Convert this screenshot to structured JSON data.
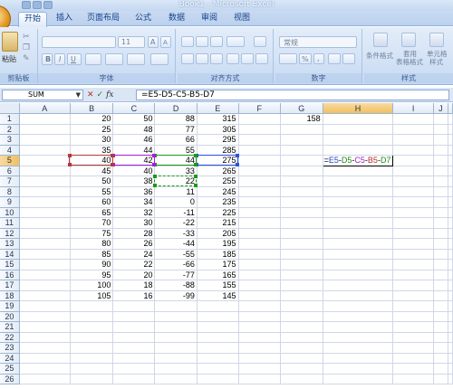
{
  "window": {
    "title": "Book1 - Microsoft Excel"
  },
  "tabs": [
    {
      "label": "开始",
      "active": true
    },
    {
      "label": "插入",
      "active": false
    },
    {
      "label": "页面布局",
      "active": false
    },
    {
      "label": "公式",
      "active": false
    },
    {
      "label": "数据",
      "active": false
    },
    {
      "label": "审阅",
      "active": false
    },
    {
      "label": "视图",
      "active": false
    }
  ],
  "ribbon": {
    "groups": {
      "clipboard": "剪贴板",
      "font": "字体",
      "alignment": "对齐方式",
      "number": "数字",
      "styles": "样式"
    },
    "paste_label": "粘贴",
    "font_size": "11",
    "number_format": "常规",
    "conditional_format": "条件格式",
    "format_as_table_line1": "套用",
    "format_as_table_line2": "表格格式",
    "cell_styles_line1": "单元格",
    "cell_styles_line2": "样式",
    "bold": "B",
    "italic": "I",
    "underline": "U",
    "grow_font": "A",
    "shrink_font": "A",
    "percent": "%",
    "comma": ","
  },
  "formula_bar": {
    "name_box": "SUM",
    "fx": "fx",
    "formula": "=E5-D5-C5-B5-D7"
  },
  "sheet": {
    "columns": [
      "A",
      "B",
      "C",
      "D",
      "E",
      "F",
      "G",
      "H",
      "I",
      "J"
    ],
    "selected_column": "H",
    "selected_row": 5,
    "rows": [
      {
        "n": 1,
        "B": "20",
        "C": "50",
        "D": "88",
        "E": "315",
        "G": "158"
      },
      {
        "n": 2,
        "B": "25",
        "C": "48",
        "D": "77",
        "E": "305"
      },
      {
        "n": 3,
        "B": "30",
        "C": "46",
        "D": "66",
        "E": "295"
      },
      {
        "n": 4,
        "B": "35",
        "C": "44",
        "D": "55",
        "E": "285"
      },
      {
        "n": 5,
        "B": "40",
        "C": "42",
        "D": "44",
        "E": "275"
      },
      {
        "n": 6,
        "B": "45",
        "C": "40",
        "D": "33",
        "E": "265"
      },
      {
        "n": 7,
        "B": "50",
        "C": "38",
        "D": "22",
        "E": "255"
      },
      {
        "n": 8,
        "B": "55",
        "C": "36",
        "D": "11",
        "E": "245"
      },
      {
        "n": 9,
        "B": "60",
        "C": "34",
        "D": "0",
        "E": "235"
      },
      {
        "n": 10,
        "B": "65",
        "C": "32",
        "D": "-11",
        "E": "225"
      },
      {
        "n": 11,
        "B": "70",
        "C": "30",
        "D": "-22",
        "E": "215"
      },
      {
        "n": 12,
        "B": "75",
        "C": "28",
        "D": "-33",
        "E": "205"
      },
      {
        "n": 13,
        "B": "80",
        "C": "26",
        "D": "-44",
        "E": "195"
      },
      {
        "n": 14,
        "B": "85",
        "C": "24",
        "D": "-55",
        "E": "185"
      },
      {
        "n": 15,
        "B": "90",
        "C": "22",
        "D": "-66",
        "E": "175"
      },
      {
        "n": 16,
        "B": "95",
        "C": "20",
        "D": "-77",
        "E": "165"
      },
      {
        "n": 17,
        "B": "100",
        "C": "18",
        "D": "-88",
        "E": "155"
      },
      {
        "n": 18,
        "B": "105",
        "C": "16",
        "D": "-99",
        "E": "145"
      },
      {
        "n": 19
      },
      {
        "n": 20
      },
      {
        "n": 21
      },
      {
        "n": 22
      },
      {
        "n": 23
      },
      {
        "n": 24
      },
      {
        "n": 25
      },
      {
        "n": 26
      }
    ],
    "editing_cell": {
      "col": "H",
      "row": 5,
      "parts": [
        {
          "text": "=",
          "color": "#000000"
        },
        {
          "text": "E5",
          "color": "#1f3fd1"
        },
        {
          "text": "-",
          "color": "#000000"
        },
        {
          "text": "D5",
          "color": "#1a8a1a"
        },
        {
          "text": "-",
          "color": "#000000"
        },
        {
          "text": "C5",
          "color": "#a020c8"
        },
        {
          "text": "-",
          "color": "#000000"
        },
        {
          "text": "B5",
          "color": "#b03030"
        },
        {
          "text": "-",
          "color": "#000000"
        },
        {
          "text": "D7",
          "color": "#1a8a1a"
        }
      ]
    },
    "reference_colors": {
      "E5": "#2b4fe0",
      "D5": "#1a9a1a",
      "C5": "#a020d8",
      "B5": "#b23a3a",
      "D7": "#1a9a1a"
    }
  }
}
